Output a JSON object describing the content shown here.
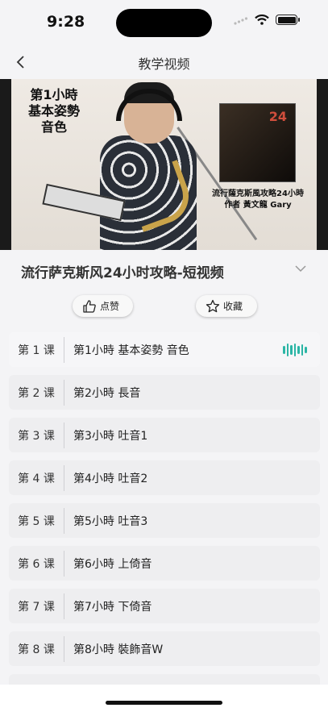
{
  "status_bar": {
    "time": "9:28"
  },
  "nav": {
    "title": "教学视频"
  },
  "video": {
    "overlay_text": "第1小時\n基本姿勢\n音色",
    "poster_number": "24",
    "poster_caption_line1": "流行薩克斯風攻略24小時",
    "poster_caption_line2": "作者 黃文龍 Gary"
  },
  "course": {
    "title": "流行萨克斯风24小时攻略-短视频"
  },
  "actions": {
    "like_label": "点赞",
    "favorite_label": "收藏"
  },
  "accent_color": "#2bb5a5",
  "lessons": [
    {
      "num": "第 1 课",
      "title": "第1小時 基本姿勢 音色",
      "playing": true
    },
    {
      "num": "第 2 课",
      "title": "第2小時 長音"
    },
    {
      "num": "第 3 课",
      "title": "第3小時 吐音1"
    },
    {
      "num": "第 4 课",
      "title": "第4小時 吐音2"
    },
    {
      "num": "第 5 课",
      "title": "第5小時 吐音3"
    },
    {
      "num": "第 6 课",
      "title": "第6小時 上倚音"
    },
    {
      "num": "第 7 课",
      "title": "第7小時 下倚音"
    },
    {
      "num": "第 8 课",
      "title": "第8小時 裝飾音W"
    }
  ]
}
